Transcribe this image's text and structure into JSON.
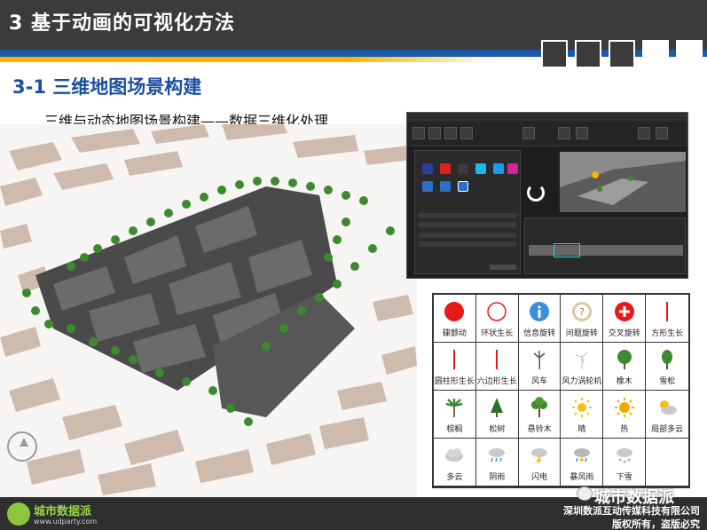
{
  "header": {
    "title": "3 基于动画的可视化方法"
  },
  "section": {
    "title": "3-1 三维地图场景构建",
    "caption": "三维与动态地图场景构建——数据三维化处理"
  },
  "colors": {
    "header_bg": "#3b3b3b",
    "accent_blue": "#1c5aa8",
    "accent_yellow": "#f4b400",
    "title_blue": "#1c4fa0"
  },
  "icon_grid": [
    {
      "label": "碟颤动",
      "icon": "red-dot-icon"
    },
    {
      "label": "环状生长",
      "icon": "ring-icon"
    },
    {
      "label": "信息旋转",
      "icon": "info-icon"
    },
    {
      "label": "问题旋转",
      "icon": "question-icon"
    },
    {
      "label": "交叉旋转",
      "icon": "cross-circle-icon"
    },
    {
      "label": "方形生长",
      "icon": "red-line-icon"
    },
    {
      "label": "圆柱形生长",
      "icon": "red-line-icon"
    },
    {
      "label": "六边形生长",
      "icon": "red-line-icon"
    },
    {
      "label": "风车",
      "icon": "windmill-icon"
    },
    {
      "label": "风力涡轮机",
      "icon": "wind-turbine-icon"
    },
    {
      "label": "橡木",
      "icon": "oak-tree-icon"
    },
    {
      "label": "雪松",
      "icon": "cedar-tree-icon"
    },
    {
      "label": "棕榈",
      "icon": "palm-tree-icon"
    },
    {
      "label": "松树",
      "icon": "pine-tree-icon"
    },
    {
      "label": "悬铃木",
      "icon": "plane-tree-icon"
    },
    {
      "label": "晴",
      "icon": "sun-icon"
    },
    {
      "label": "热",
      "icon": "hot-sun-icon"
    },
    {
      "label": "局部多云",
      "icon": "partly-cloudy-icon"
    },
    {
      "label": "多云",
      "icon": "cloudy-icon"
    },
    {
      "label": "阴雨",
      "icon": "rain-icon"
    },
    {
      "label": "闪电",
      "icon": "lightning-icon"
    },
    {
      "label": "暴风雨",
      "icon": "storm-icon"
    },
    {
      "label": "下雪",
      "icon": "snow-icon"
    }
  ],
  "footer": {
    "logo_text": "城市数据派",
    "logo_url": "www.udparty.com",
    "company": "深圳数派互动传媒科技有限公司",
    "rights": "版权所有，盗版必究"
  },
  "watermark": "城市数据派"
}
